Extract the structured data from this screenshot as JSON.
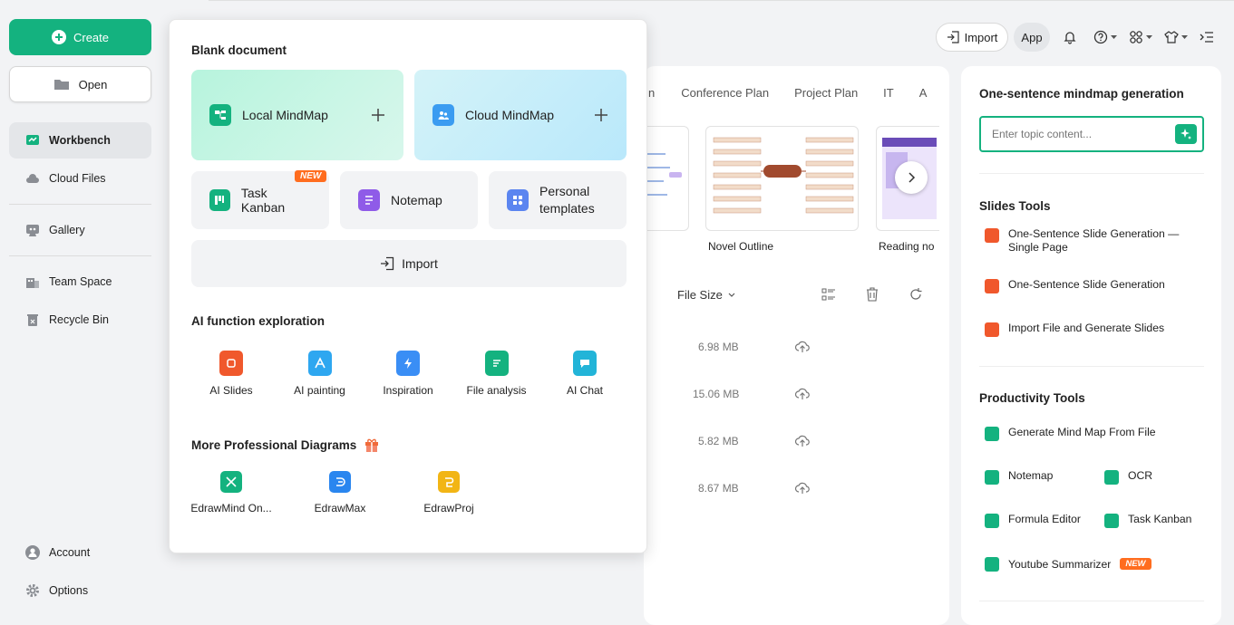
{
  "sidebar": {
    "create_label": "Create",
    "open_label": "Open",
    "nav": [
      {
        "label": "Workbench",
        "icon": "workbench-icon"
      },
      {
        "label": "Cloud Files",
        "icon": "cloud-icon"
      },
      {
        "label": "Gallery",
        "icon": "gallery-icon"
      },
      {
        "label": "Team Space",
        "icon": "team-icon"
      },
      {
        "label": "Recycle Bin",
        "icon": "trash-icon"
      }
    ],
    "account_label": "Account",
    "options_label": "Options"
  },
  "topbar": {
    "import_label": "Import",
    "app_label": "App"
  },
  "templates": {
    "tabs": [
      "n",
      "Conference Plan",
      "Project Plan",
      "IT",
      "A"
    ],
    "cards": [
      {
        "label": ""
      },
      {
        "label": "Novel Outline"
      },
      {
        "label": "Reading no"
      }
    ]
  },
  "files": {
    "sort_label": "File Size",
    "sizes": [
      "6.98 MB",
      "15.06 MB",
      "5.82 MB",
      "8.67 MB"
    ]
  },
  "popup": {
    "blank_title": "Blank document",
    "local_mindmap": "Local MindMap",
    "cloud_mindmap": "Cloud MindMap",
    "task_kanban": "Task Kanban",
    "new_badge": "NEW",
    "notemap": "Notemap",
    "personal_templates_1": "Personal",
    "personal_templates_2": "templates",
    "import_label": "Import",
    "ai_title": "AI function exploration",
    "ai_items": [
      "AI Slides",
      "AI painting",
      "Inspiration",
      "File analysis",
      "AI Chat"
    ],
    "more_title": "More Professional Diagrams",
    "apps": [
      "EdrawMind On...",
      "EdrawMax",
      "EdrawProj"
    ]
  },
  "right": {
    "oneline_title": "One-sentence mindmap generation",
    "topic_placeholder": "Enter topic content...",
    "slides_title": "Slides Tools",
    "slides_items": [
      "One-Sentence Slide Generation —",
      "Single Page",
      "One-Sentence Slide Generation",
      "Import File and Generate Slides"
    ],
    "prod_title": "Productivity Tools",
    "prod_items": [
      "Generate Mind Map From File",
      "Notemap",
      "OCR",
      "Formula Editor",
      "Task Kanban",
      "Youtube Summarizer"
    ],
    "new_badge": "NEW"
  },
  "colors": {
    "accent": "#14b27f",
    "new_badge": "#ff6d1f"
  }
}
